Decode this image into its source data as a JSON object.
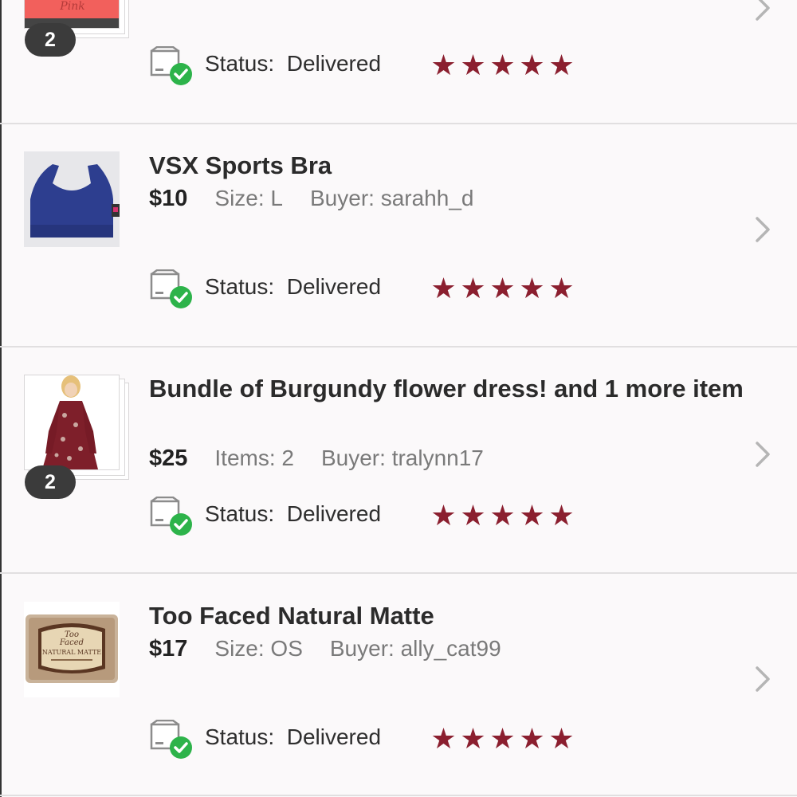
{
  "status_label": "Status:",
  "orders": [
    {
      "title": "",
      "price": "",
      "attr": "",
      "buyer": "",
      "image_count": "2",
      "status": "Delivered",
      "rating": 5
    },
    {
      "title": "VSX Sports Bra",
      "price": "$10",
      "attr": "Size: L",
      "buyer": "Buyer: sarahh_d",
      "status": "Delivered",
      "rating": 5
    },
    {
      "title": "Bundle of Burgundy flower dress! and 1 more item",
      "price": "$25",
      "attr": "Items: 2",
      "buyer": "Buyer: tralynn17",
      "image_count": "2",
      "status": "Delivered",
      "rating": 5
    },
    {
      "title": "Too Faced Natural Matte",
      "price": "$17",
      "attr": "Size: OS",
      "buyer": "Buyer: ally_cat99",
      "status": "Delivered",
      "rating": 5,
      "thumb_text": [
        "Too",
        "Faced",
        "NATURAL MATTE"
      ]
    }
  ],
  "colors": {
    "star": "#8b1f2f",
    "delivered_check": "#2db34a",
    "chevron": "#b5b5b5",
    "divider": "#e1dfe0"
  },
  "icons": {
    "status": "package-delivered-icon",
    "chevron": "chevron-right-icon",
    "star": "star-icon"
  }
}
